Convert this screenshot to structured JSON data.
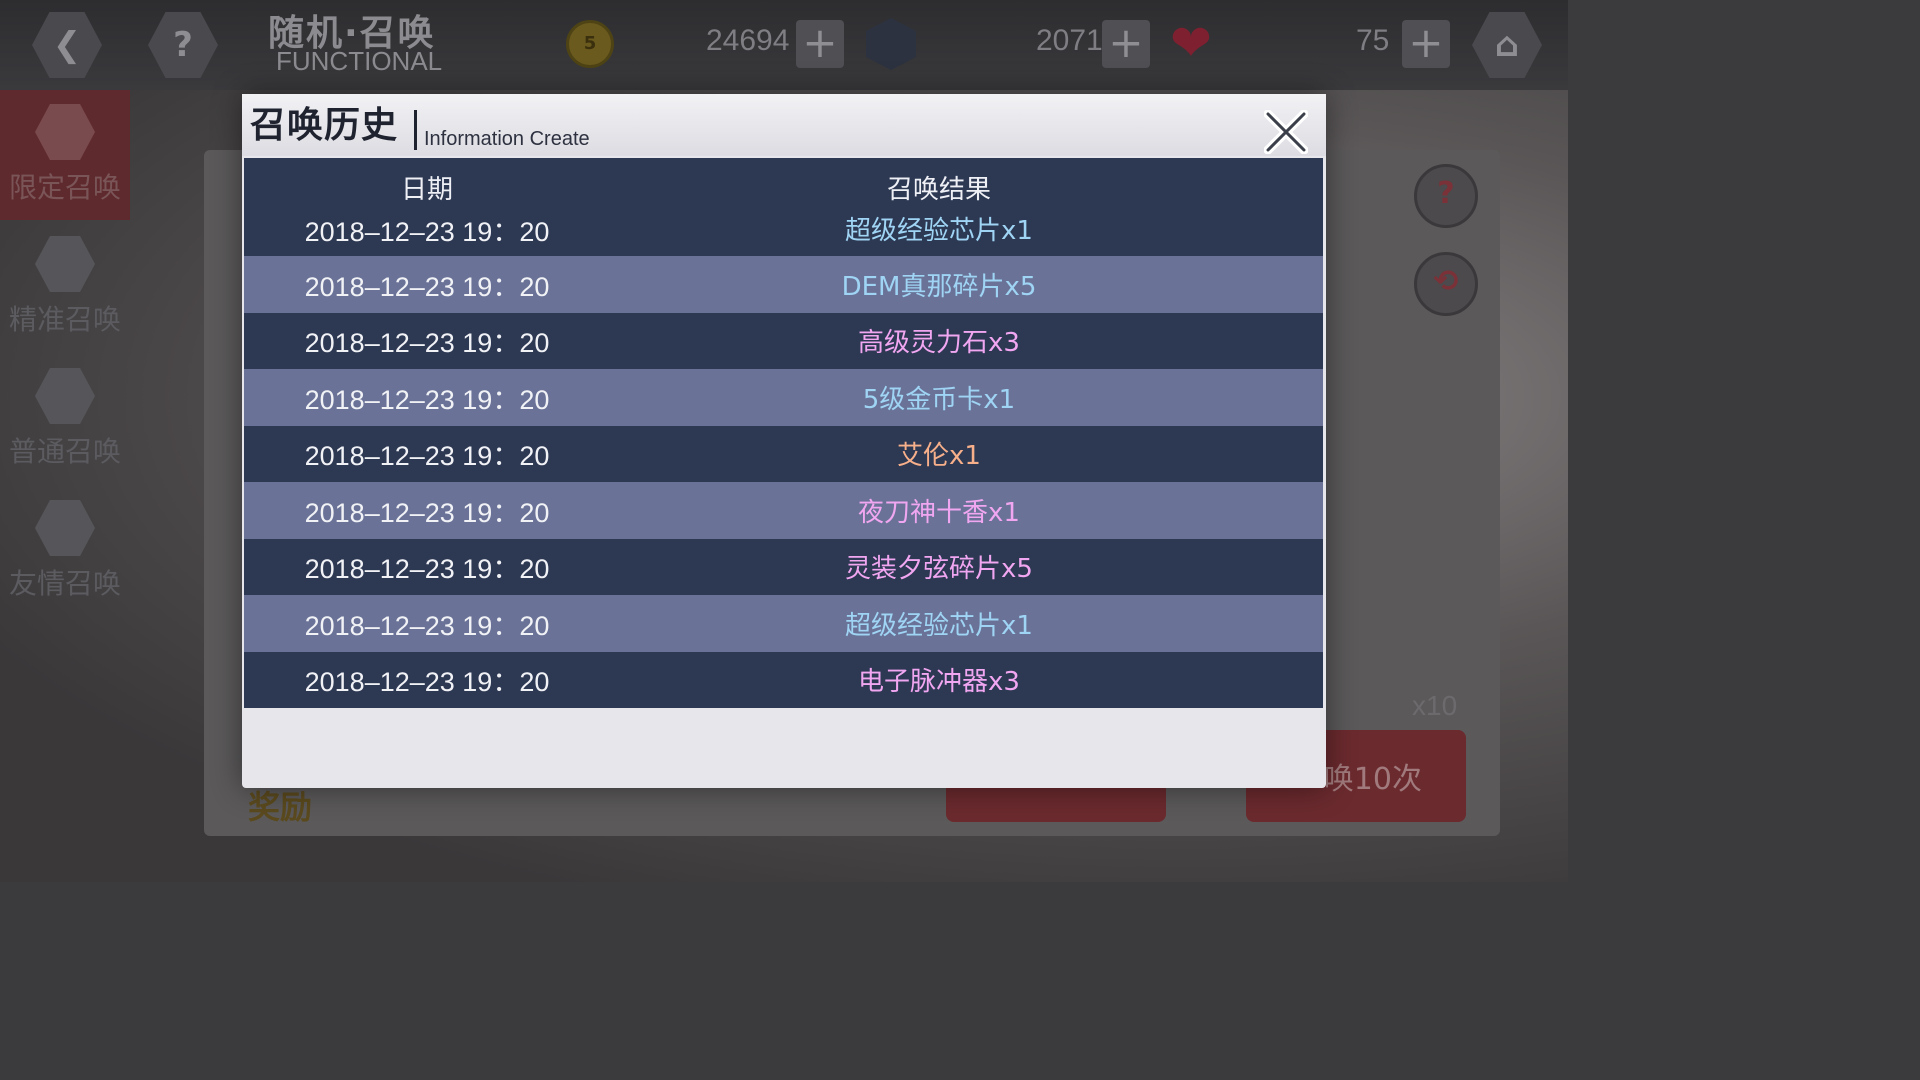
{
  "topbar": {
    "title_cn": "随机·召唤",
    "title_en": "FUNCTIONAL",
    "coin_symbol": "5",
    "coins": "24694",
    "gems": "2071",
    "hearts": "75"
  },
  "left_nav": [
    {
      "label": "限定召唤",
      "active": true
    },
    {
      "label": "精准召唤",
      "active": false
    },
    {
      "label": "普通召唤",
      "active": false
    },
    {
      "label": "友情召唤",
      "active": false
    }
  ],
  "side_buttons": {
    "help": "?",
    "history": "⟲"
  },
  "stage": {
    "x10": "x10",
    "summon10_label": "唤10次",
    "reward_label": "奖励"
  },
  "modal": {
    "title": "召唤历史",
    "subtitle": "Information Create",
    "headers": {
      "date": "日期",
      "result": "召唤结果"
    },
    "rows": [
      {
        "date": "2018–12–23 19：20",
        "result": "超级经验芯片x1",
        "color": "#9fd4f4"
      },
      {
        "date": "2018–12–23 19：20",
        "result": "DEM真那碎片x5",
        "color": "#9fd4f4"
      },
      {
        "date": "2018–12–23 19：20",
        "result": "高级灵力石x3",
        "color": "#f0a6f0"
      },
      {
        "date": "2018–12–23 19：20",
        "result": "5级金币卡x1",
        "color": "#9fd4f4"
      },
      {
        "date": "2018–12–23 19：20",
        "result": "艾伦x1",
        "color": "#f7b08a"
      },
      {
        "date": "2018–12–23 19：20",
        "result": "夜刀神十香x1",
        "color": "#f0a6f0"
      },
      {
        "date": "2018–12–23 19：20",
        "result": "灵装夕弦碎片x5",
        "color": "#f0a6f0"
      },
      {
        "date": "2018–12–23 19：20",
        "result": "超级经验芯片x1",
        "color": "#9fd4f4"
      },
      {
        "date": "2018–12–23 19：20",
        "result": "电子脉冲器x3",
        "color": "#f0a6f0"
      }
    ]
  },
  "colors": {
    "row_dark": "#2d3853",
    "row_light": "#6a7397",
    "modal_bg": "#e7e6ea"
  }
}
